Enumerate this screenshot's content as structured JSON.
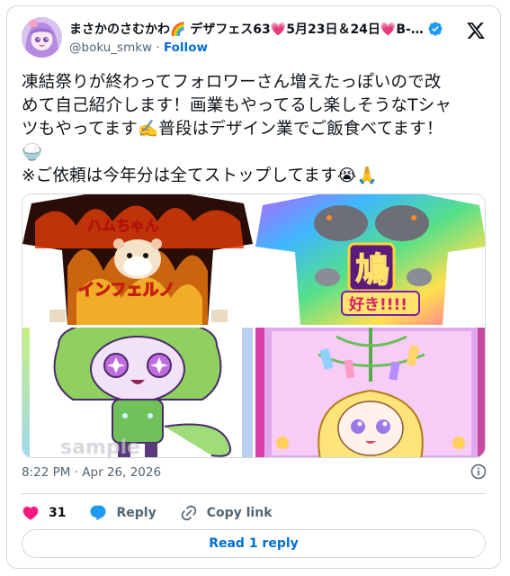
{
  "author": {
    "display_name": "まさかのさむかわ🌈 デザフェス63💗5月23日＆24日💗B-…",
    "handle": "@boku_smkw",
    "separator": "·",
    "follow_label": "Follow",
    "verified_icon": "verified-badge-icon",
    "avatar_icon": "avatar-illustration"
  },
  "tweet": {
    "lines": [
      "凍結祭りが終わってフォロワーさん増えたっぽいので改",
      "めて自己紹介します！画業もやってるし楽しそうなTシャ",
      "ツもやってます✍️普段はデザイン業でご飯食べてます！",
      "🍚",
      "※ご依頼は今年分は全てストップしてます😭🙏"
    ],
    "media": {
      "count": 4,
      "tile_1_text": "ハムちゃん インフェルノ",
      "tile_2_text": "鳩 好き!!!!",
      "tile_3_text": "sample"
    }
  },
  "meta": {
    "time": "8:22 PM",
    "separator": "·",
    "date": "Apr 26, 2026"
  },
  "actions": {
    "likes": "31",
    "reply_label": "Reply",
    "copy_label": "Copy link"
  },
  "read_replies_label": "Read 1 reply",
  "colors": {
    "brand_blue": "#1d9bf0",
    "link_blue": "#006fd6",
    "like_pink": "#f91880",
    "muted": "#536471",
    "border": "#cfd9de"
  }
}
